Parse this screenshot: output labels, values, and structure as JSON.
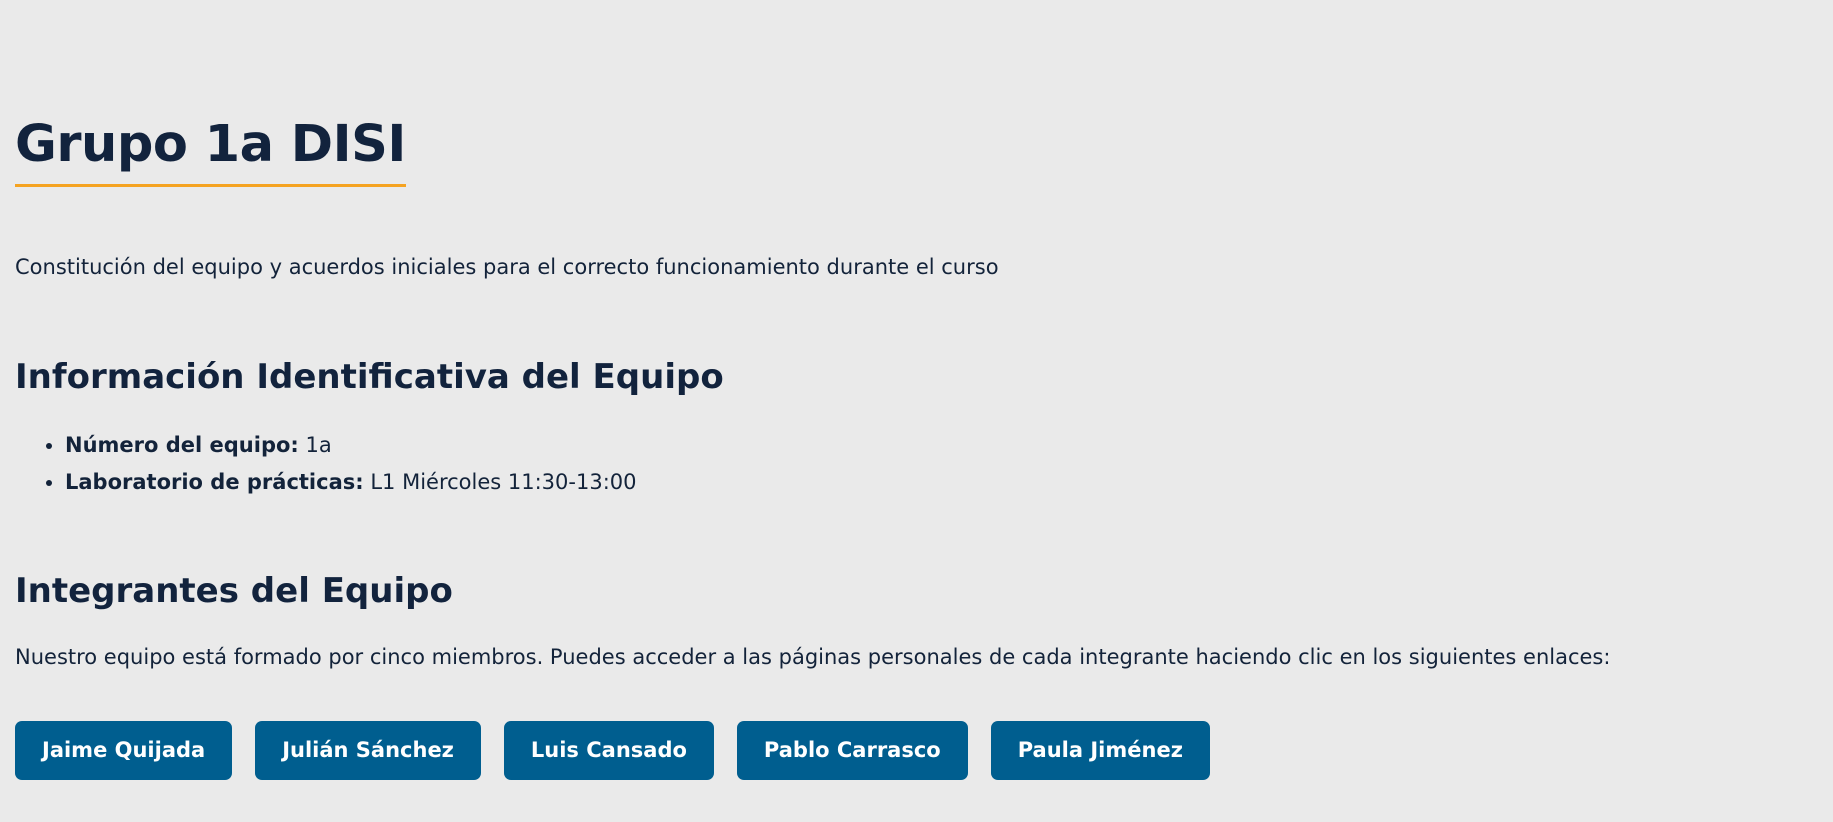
{
  "header": {
    "title": "Grupo 1a DISI",
    "subtitle": "Constitución del equipo y acuerdos iniciales para el correcto funcionamiento durante el curso"
  },
  "info_section": {
    "heading": "Información Identificativa del Equipo",
    "items": [
      {
        "label": "Número del equipo:",
        "value": "1a"
      },
      {
        "label": "Laboratorio de prácticas:",
        "value": "L1 Miércoles 11:30-13:00"
      }
    ]
  },
  "members_section": {
    "heading": "Integrantes del Equipo",
    "intro": "Nuestro equipo está formado por cinco miembros. Puedes acceder a las páginas personales de cada integrante haciendo clic en los siguientes enlaces:",
    "members": [
      {
        "name": "Jaime Quijada"
      },
      {
        "name": "Julián Sánchez"
      },
      {
        "name": "Luis Cansado"
      },
      {
        "name": "Pablo Carrasco"
      },
      {
        "name": "Paula Jiménez"
      }
    ]
  },
  "colors": {
    "background": "#eaeaea",
    "heading": "#12233d",
    "accent_underline": "#f5a321",
    "button": "#005e8f",
    "button_text": "#ffffff"
  }
}
